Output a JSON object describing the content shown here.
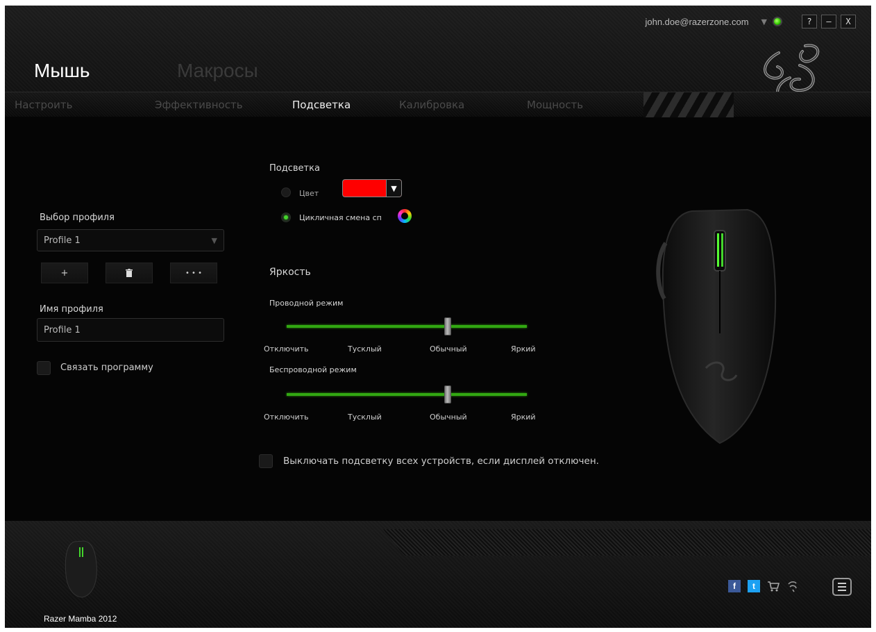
{
  "account": {
    "email": "john.doe@razerzone.com"
  },
  "window_controls": {
    "help": "?",
    "minimize": "–",
    "close": "X"
  },
  "main_tabs": [
    {
      "label": "Мышь",
      "active": true
    },
    {
      "label": "Макросы",
      "active": false
    }
  ],
  "sub_tabs": [
    {
      "label": "Настроить",
      "active": false
    },
    {
      "label": "Эффективность",
      "active": false
    },
    {
      "label": "Подсветка",
      "active": true
    },
    {
      "label": "Калибровка",
      "active": false
    },
    {
      "label": "Мощность",
      "active": false
    }
  ],
  "profile": {
    "select_label": "Выбор профиля",
    "selected": "Profile 1",
    "add_label": "+",
    "more_label": "• • •",
    "name_label": "Имя профиля",
    "name_value": "Profile 1",
    "link_program_label": "Связать программу",
    "link_program_checked": false
  },
  "lighting": {
    "title": "Подсветка",
    "color_option_label": "Цвет",
    "color_value": "#ff0000",
    "spectrum_option_label": "Цикличная смена сп",
    "selected_mode": "spectrum"
  },
  "brightness": {
    "title": "Яркость",
    "wired": {
      "label": "Проводной режим",
      "level_fraction": 0.67,
      "ticks": [
        "Отключить",
        "Тусклый",
        "Обычный",
        "Яркий"
      ]
    },
    "wireless": {
      "label": "Беспроводной режим",
      "level_fraction": 0.67,
      "ticks": [
        "Отключить",
        "Тусклый",
        "Обычный",
        "Яркий"
      ]
    }
  },
  "display_off_option": {
    "label": "Выключать подсветку всех устройств, если дисплей отключен.",
    "checked": false
  },
  "footer": {
    "device_name": "Razer Mamba 2012",
    "social": {
      "facebook": "f",
      "twitter": "t"
    }
  },
  "colors": {
    "accent": "#44d62c",
    "background": "#050505"
  }
}
